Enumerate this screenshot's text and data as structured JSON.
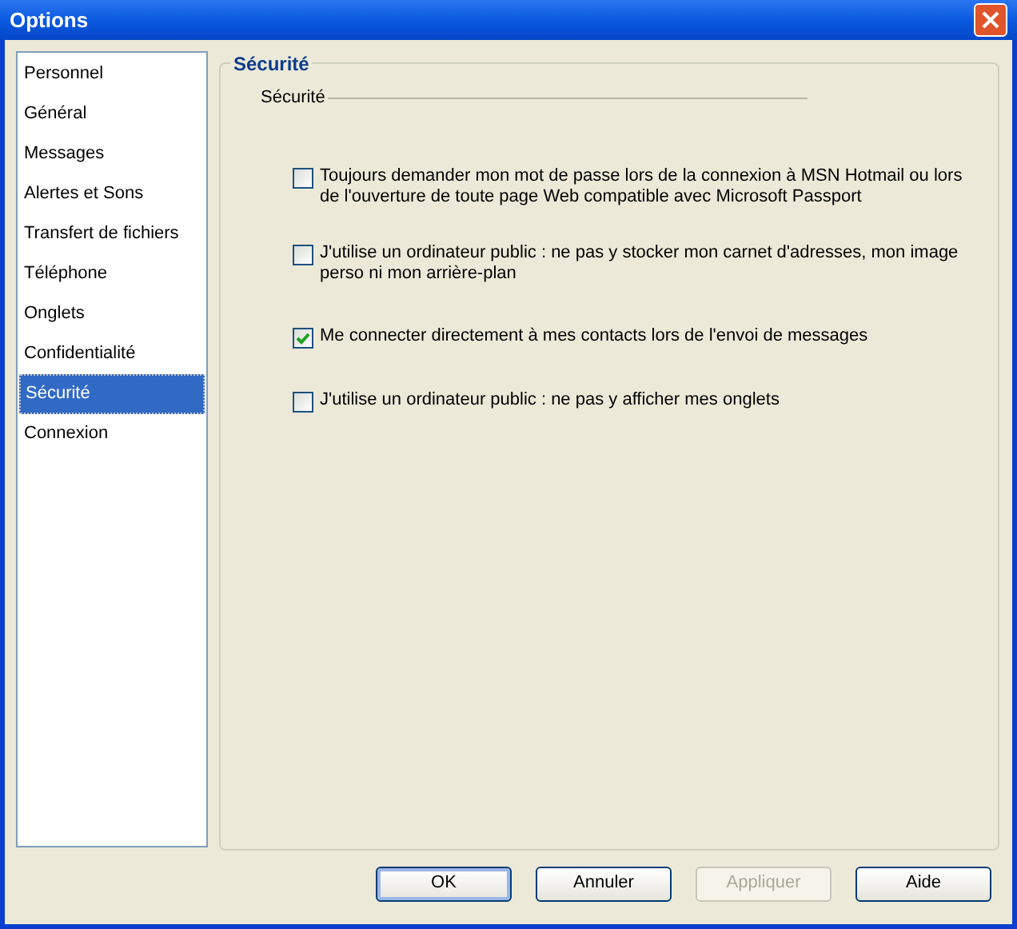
{
  "window": {
    "title": "Options"
  },
  "sidebar": {
    "items": [
      {
        "label": "Personnel",
        "selected": false
      },
      {
        "label": "Général",
        "selected": false
      },
      {
        "label": "Messages",
        "selected": false
      },
      {
        "label": "Alertes et Sons",
        "selected": false
      },
      {
        "label": "Transfert de fichiers",
        "selected": false
      },
      {
        "label": "Téléphone",
        "selected": false
      },
      {
        "label": "Onglets",
        "selected": false
      },
      {
        "label": "Confidentialité",
        "selected": false
      },
      {
        "label": "Sécurité",
        "selected": true
      },
      {
        "label": "Connexion",
        "selected": false
      }
    ]
  },
  "panel": {
    "title": "Sécurité",
    "group": "Sécurité",
    "options": [
      {
        "label": "Toujours demander mon mot de passe lors de la connexion à MSN Hotmail ou lors de l'ouverture de toute page Web compatible avec Microsoft Passport",
        "checked": false
      },
      {
        "label": "J'utilise un ordinateur public : ne pas y stocker mon carnet d'adresses, mon image perso ni mon arrière-plan",
        "checked": false
      },
      {
        "label": "Me connecter directement à mes contacts lors de l'envoi de messages",
        "checked": true
      },
      {
        "label": "J'utilise un ordinateur public : ne pas y afficher mes onglets",
        "checked": false
      }
    ]
  },
  "buttons": [
    {
      "label": "OK",
      "disabled": false,
      "default": true
    },
    {
      "label": "Annuler",
      "disabled": false,
      "default": false
    },
    {
      "label": "Appliquer",
      "disabled": true,
      "default": false
    },
    {
      "label": "Aide",
      "disabled": false,
      "default": false
    }
  ]
}
